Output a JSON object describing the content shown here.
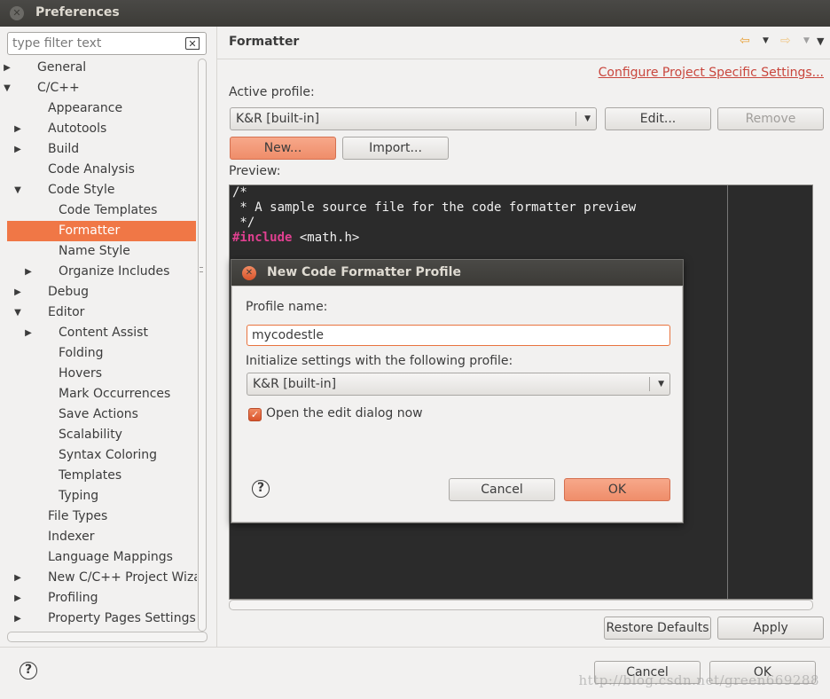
{
  "window": {
    "title": "Preferences"
  },
  "filter": {
    "placeholder": "type filter text"
  },
  "tree": [
    {
      "label": "General",
      "level": 0,
      "arrow": "▶"
    },
    {
      "label": "C/C++",
      "level": 0,
      "arrow": "▼"
    },
    {
      "label": "Appearance",
      "level": 1,
      "arrow": ""
    },
    {
      "label": "Autotools",
      "level": 1,
      "arrow": "▶"
    },
    {
      "label": "Build",
      "level": 1,
      "arrow": "▶"
    },
    {
      "label": "Code Analysis",
      "level": 1,
      "arrow": ""
    },
    {
      "label": "Code Style",
      "level": 1,
      "arrow": "▼"
    },
    {
      "label": "Code Templates",
      "level": 2,
      "arrow": ""
    },
    {
      "label": "Formatter",
      "level": 2,
      "arrow": "",
      "selected": true
    },
    {
      "label": "Name Style",
      "level": 2,
      "arrow": ""
    },
    {
      "label": "Organize Includes",
      "level": 2,
      "arrow": "▶"
    },
    {
      "label": "Debug",
      "level": 1,
      "arrow": "▶"
    },
    {
      "label": "Editor",
      "level": 1,
      "arrow": "▼"
    },
    {
      "label": "Content Assist",
      "level": 2,
      "arrow": "▶"
    },
    {
      "label": "Folding",
      "level": 2,
      "arrow": ""
    },
    {
      "label": "Hovers",
      "level": 2,
      "arrow": ""
    },
    {
      "label": "Mark Occurrences",
      "level": 2,
      "arrow": ""
    },
    {
      "label": "Save Actions",
      "level": 2,
      "arrow": ""
    },
    {
      "label": "Scalability",
      "level": 2,
      "arrow": ""
    },
    {
      "label": "Syntax Coloring",
      "level": 2,
      "arrow": ""
    },
    {
      "label": "Templates",
      "level": 2,
      "arrow": ""
    },
    {
      "label": "Typing",
      "level": 2,
      "arrow": ""
    },
    {
      "label": "File Types",
      "level": 1,
      "arrow": ""
    },
    {
      "label": "Indexer",
      "level": 1,
      "arrow": ""
    },
    {
      "label": "Language Mappings",
      "level": 1,
      "arrow": ""
    },
    {
      "label": "New C/C++ Project Wizar",
      "level": 1,
      "arrow": "▶"
    },
    {
      "label": "Profiling",
      "level": 1,
      "arrow": "▶"
    },
    {
      "label": "Property Pages Settings",
      "level": 1,
      "arrow": "▶"
    }
  ],
  "page": {
    "title": "Formatter",
    "configure_link": "Configure Project Specific Settings...",
    "active_profile_label": "Active profile:",
    "active_profile_value": "K&R [built-in]",
    "edit_button": "Edit...",
    "remove_button": "Remove",
    "new_button": "New...",
    "import_button": "Import...",
    "preview_label": "Preview:",
    "restore_defaults_button": "Restore Defaults",
    "apply_button": "Apply"
  },
  "preview_code": {
    "line1": "/*",
    "line2": " * A sample source file for the code formatter preview",
    "line3": " */",
    "line4_keyword": "#include",
    "line4_rest": " <math.h>"
  },
  "dialog": {
    "title": "New Code Formatter Profile",
    "profile_name_label": "Profile name:",
    "profile_name_value": "mycodestle",
    "init_label": "Initialize settings with the following profile:",
    "init_value": "K&R [built-in]",
    "open_edit_label": "Open the edit dialog now",
    "open_edit_checked": true,
    "cancel_button": "Cancel",
    "ok_button": "OK"
  },
  "footer": {
    "cancel_button": "Cancel",
    "ok_button": "OK",
    "watermark": "http://blog.csdn.net/green669288"
  },
  "colors": {
    "accent": "#f07746",
    "link": "#c9463d",
    "preview_bg": "#2b2b2b",
    "keyword": "#e04090"
  }
}
